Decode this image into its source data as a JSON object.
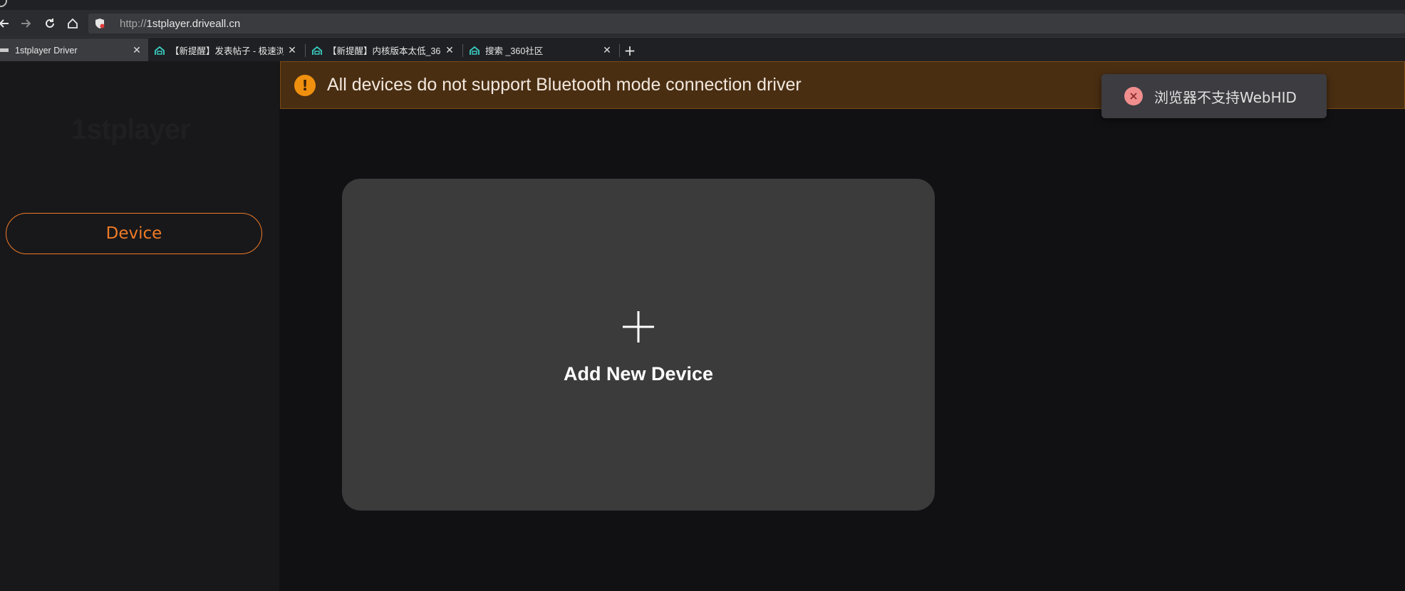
{
  "browser": {
    "url_protocol": "http://",
    "url_host": "1stplayer.driveall.cn",
    "tabs": [
      {
        "title": "1stplayer Driver",
        "active": true
      },
      {
        "title": "【新提醒】发表帖子 - 极速浏",
        "active": false
      },
      {
        "title": "【新提醒】内核版本太低_360",
        "active": false
      },
      {
        "title": "搜索 _360社区",
        "active": false
      }
    ],
    "new_tab_label": "+"
  },
  "sidebar": {
    "brand": "1stplayer",
    "nav_device": "Device"
  },
  "warning": {
    "icon": "exclamation-icon",
    "text": "All devices do not support Bluetooth mode connection driver",
    "color": "#f0900f"
  },
  "toast": {
    "icon": "error-close-icon",
    "text": "浏览器不支持WebHID"
  },
  "main": {
    "add_device_label": "Add New Device"
  },
  "colors": {
    "accent": "#f07a24",
    "warning_bg": "#4a2e12",
    "card_bg": "#3b3b3c",
    "toast_icon": "#f08e8e"
  }
}
